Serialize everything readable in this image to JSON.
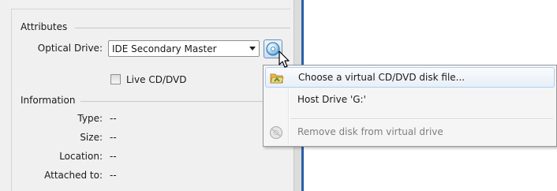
{
  "attributes": {
    "section_label": "Attributes",
    "optical_drive_label": "Optical Drive:",
    "optical_drive_value": "IDE Secondary Master",
    "live_cd_label": "Live CD/DVD",
    "live_cd_checked": false
  },
  "information": {
    "section_label": "Information",
    "fields": [
      {
        "label": "Type:",
        "value": "--"
      },
      {
        "label": "Size:",
        "value": "--"
      },
      {
        "label": "Location:",
        "value": "--"
      },
      {
        "label": "Attached to:",
        "value": "--"
      }
    ]
  },
  "context_menu": {
    "items": [
      {
        "label": "Choose a virtual CD/DVD disk file...",
        "icon": "folder-open-icon",
        "highlighted": true,
        "enabled": true
      },
      {
        "label": "Host Drive 'G:'",
        "icon": "",
        "highlighted": false,
        "enabled": true
      },
      {
        "label": "Remove disk from virtual drive",
        "icon": "eject-disc-icon",
        "highlighted": false,
        "enabled": false
      }
    ]
  },
  "icons": {
    "disc_button": "cd-dvd-disc-icon",
    "cursor": "mouse-pointer-icon"
  },
  "colors": {
    "panel_background": "#f0f0f0",
    "menu_highlight_border": "#aecff7",
    "divider_blue": "#2a5fa8"
  }
}
